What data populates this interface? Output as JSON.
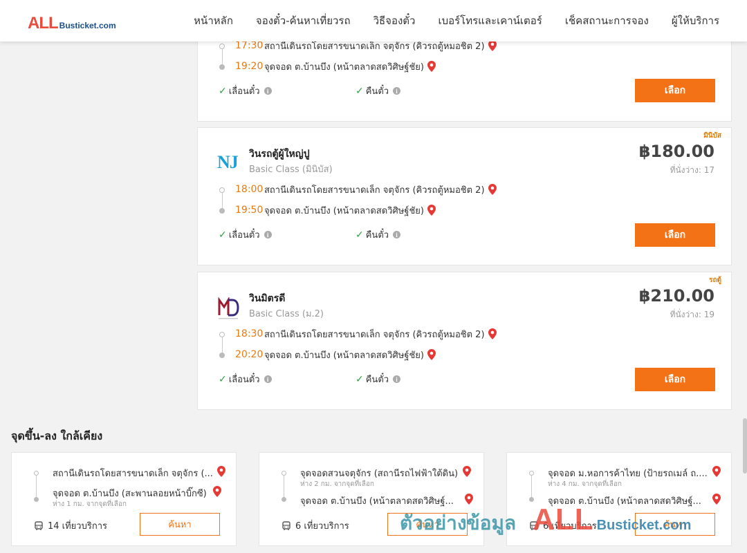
{
  "header": {
    "logo_big": "ALL",
    "logo_small": "Busticket.com",
    "nav": [
      "หน้าหลัก",
      "จองตั๋ว-ค้นหาเที่ยวรถ",
      "วิธีจองตั๋ว",
      "เบอร์โทรและเคาน์เตอร์",
      "เช็คสถานะการจอง",
      "ผู้ให้บริการ"
    ]
  },
  "trips": [
    {
      "depart_time": "17:30",
      "depart_place": "สถานีเดินรถโดยสารขนาดเล็ก จตุจักร (คิวรถตู้หมอชิต 2)",
      "arrive_time": "19:20",
      "arrive_place": "จุดจอด ต.บ้านบึง (หน้าตลาดสดวิศิษฐ์ชัย)",
      "feature_1": "เลื่อนตั๋ว",
      "feature_2": "คืนตั๋ว",
      "button": "เลือก"
    },
    {
      "tag": "มินิบัส",
      "operator": "วินรถตู้ผู้ใหญ่ปู",
      "class": "Basic Class (มินิบัส)",
      "logo_text": "NJ",
      "price": "฿180.00",
      "seats": "ที่นั่งว่าง: 17",
      "depart_time": "18:00",
      "depart_place": "สถานีเดินรถโดยสารขนาดเล็ก จตุจักร (คิวรถตู้หมอชิต 2)",
      "arrive_time": "19:50",
      "arrive_place": "จุดจอด ต.บ้านบึง (หน้าตลาดสดวิศิษฐ์ชัย)",
      "feature_1": "เลื่อนตั๋ว",
      "feature_2": "คืนตั๋ว",
      "button": "เลือก"
    },
    {
      "tag": "รถตู้",
      "operator": "วินมิตรดี",
      "class": "Basic Class (ม.2)",
      "logo_text": "MD",
      "price": "฿210.00",
      "seats": "ที่นั่งว่าง: 19",
      "depart_time": "18:30",
      "depart_place": "สถานีเดินรถโดยสารขนาดเล็ก จตุจักร (คิวรถตู้หมอชิต 2)",
      "arrive_time": "20:20",
      "arrive_place": "จุดจอด ต.บ้านบึง (หน้าตลาดสดวิศิษฐ์ชัย)",
      "feature_1": "เลื่อนตั๋ว",
      "feature_2": "คืนตั๋ว",
      "button": "เลือก"
    }
  ],
  "nearby": {
    "title": "จุดขึ้น-ลง ใกล้เคียง",
    "cards": [
      {
        "from": "สถานีเดินรถโดยสารขนาดเล็ก จตุจักร (...",
        "from_dist": "",
        "to": "จุดจอด ต.บ้านบึง (สะพานลอยหน้าบิ๊กซี)",
        "to_dist": "ห่าง 1 กม. จากจุดที่เลือก",
        "trips": "14 เที่ยวบริการ",
        "button": "ค้นหา"
      },
      {
        "from": "จุดจอดสวนจตุจักร (สถานีรถไฟฟ้าใต้ดิน)",
        "from_dist": "ห่าง 2 กม. จากจุดที่เลือก",
        "to": "จุดจอด ต.บ้านบึง (หน้าตลาดสดวิศิษฐ์...",
        "to_dist": "",
        "trips": "6 เที่ยวบริการ",
        "button": "ค้นหา"
      },
      {
        "from": "จุดจอด ม.หอการค้าไทย (ป้ายรถเมล์ ถ....",
        "from_dist": "ห่าง 4 กม. จากจุดที่เลือก",
        "to": "จุดจอด ต.บ้านบึง (หน้าตลาดสดวิศิษฐ์...",
        "to_dist": "",
        "trips": "6 เที่ยวบริการ",
        "button": "ค้นหา"
      }
    ]
  },
  "watermark": {
    "text": "ตัวอย่างข้อมูล",
    "all": "ALL",
    "busticket": "Busticket.com"
  },
  "colors": {
    "accent": "#f47216",
    "time": "#e87a10",
    "pin": "#e53935",
    "check": "#2e9e3a"
  }
}
